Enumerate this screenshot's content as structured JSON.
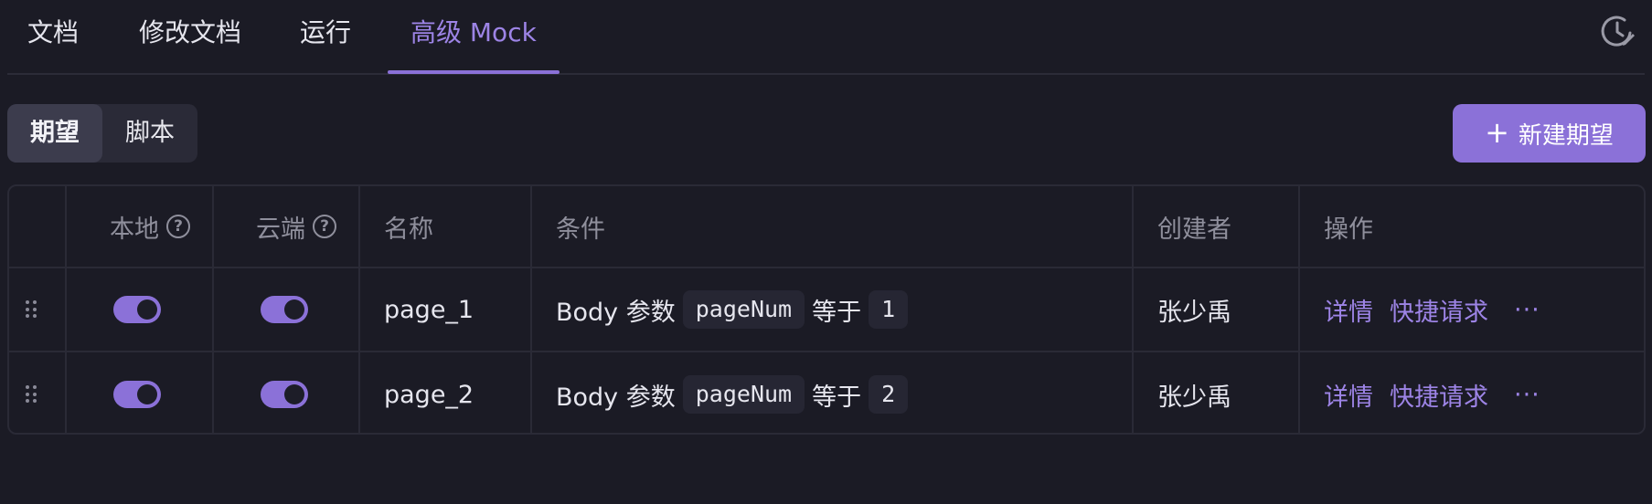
{
  "tabs": [
    {
      "label": "文档"
    },
    {
      "label": "修改文档"
    },
    {
      "label": "运行"
    },
    {
      "label": "高级 Mock"
    }
  ],
  "segment": {
    "items": [
      "期望",
      "脚本"
    ],
    "active": "期望"
  },
  "new_button": {
    "label": "新建期望"
  },
  "table": {
    "headers": {
      "local": "本地",
      "cloud": "云端",
      "name": "名称",
      "condition": "条件",
      "creator": "创建者",
      "actions": "操作"
    },
    "rows": [
      {
        "local_on": true,
        "cloud_on": true,
        "name": "page_1",
        "cond_prefix": "Body 参数",
        "cond_param": "pageNum",
        "cond_op": "等于",
        "cond_value": "1",
        "creator": "张少禹",
        "action_detail": "详情",
        "action_quick": "快捷请求",
        "action_more": "···"
      },
      {
        "local_on": true,
        "cloud_on": true,
        "name": "page_2",
        "cond_prefix": "Body 参数",
        "cond_param": "pageNum",
        "cond_op": "等于",
        "cond_value": "2",
        "creator": "张少禹",
        "action_detail": "详情",
        "action_quick": "快捷请求",
        "action_more": "···"
      }
    ]
  },
  "colors": {
    "accent": "#8b71d8",
    "background": "#1b1b25"
  }
}
